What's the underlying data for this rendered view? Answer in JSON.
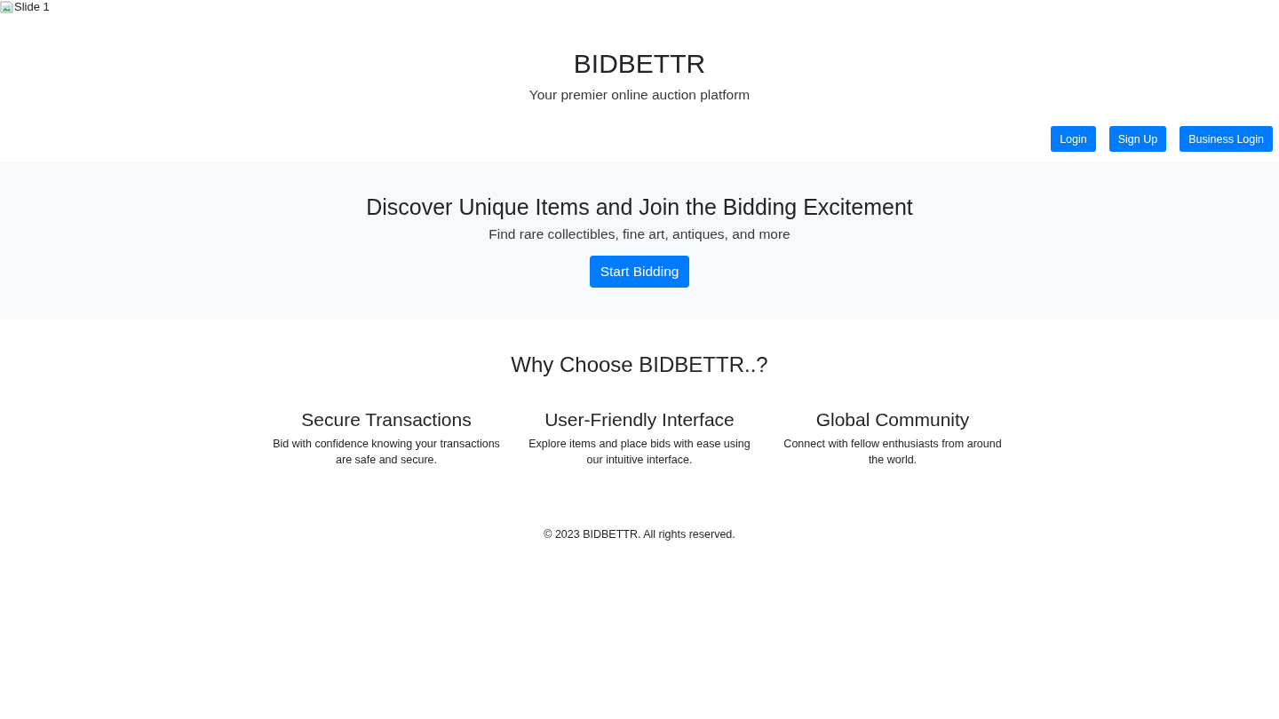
{
  "slide_image": {
    "alt": "Slide 1"
  },
  "header": {
    "title": "BIDBETTR",
    "tagline": "Your premier online auction platform"
  },
  "auth_buttons": [
    "Login",
    "Sign Up",
    "Business Login"
  ],
  "hero": {
    "title": "Discover Unique Items and Join the Bidding Excitement",
    "subtitle": "Find rare collectibles, fine art, antiques, and more",
    "button": "Start Bidding"
  },
  "features": {
    "title": "Why Choose BIDBETTR..?",
    "items": [
      {
        "title": "Secure Transactions",
        "text": "Bid with confidence knowing your transactions are safe and secure."
      },
      {
        "title": "User-Friendly Interface",
        "text": "Explore items and place bids with ease using our intuitive interface."
      },
      {
        "title": "Global Community",
        "text": "Connect with fellow enthusiasts from around the world."
      }
    ]
  },
  "footer": "© 2023 BIDBETTR. All rights reserved."
}
